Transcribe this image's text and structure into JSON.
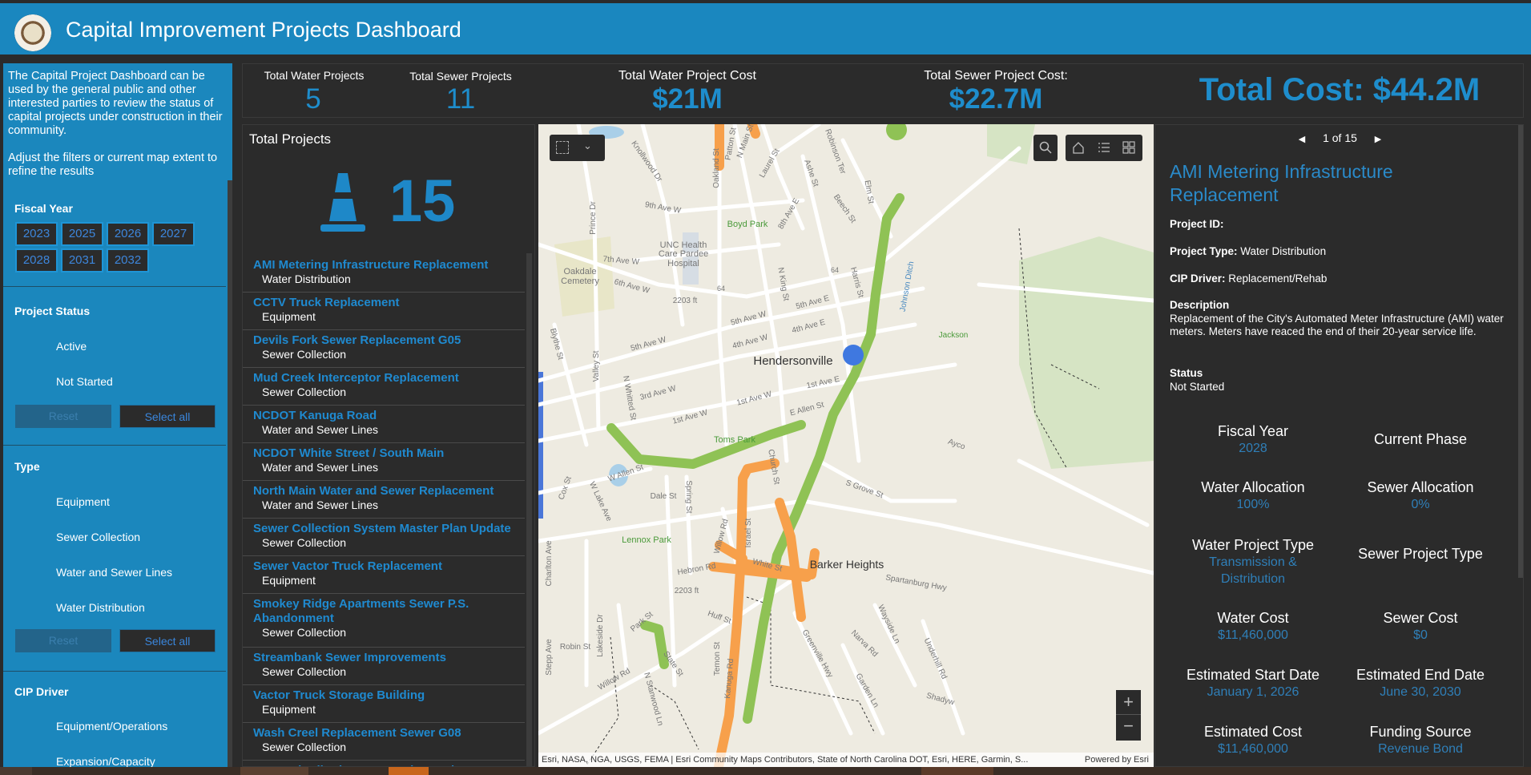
{
  "header": {
    "title": "Capital Improvement Projects Dashboard",
    "logo": "city-seal"
  },
  "sidebar": {
    "intro": "The Capital Project Dashboard can be used by the general public and other interested parties to review the status of capital projects under construction in their community.",
    "intro2": "Adjust the filters or current map extent to refine the results",
    "fiscal_year": {
      "label": "Fiscal Year",
      "years": [
        "2023",
        "2025",
        "2026",
        "2027",
        "2028",
        "2031",
        "2032"
      ]
    },
    "project_status": {
      "label": "Project Status",
      "options": [
        "Active",
        "Not Started"
      ],
      "reset": "Reset",
      "select_all": "Select all"
    },
    "type": {
      "label": "Type",
      "options": [
        "Equipment",
        "Sewer Collection",
        "Water and Sewer Lines",
        "Water Distribution"
      ],
      "reset": "Reset",
      "select_all": "Select all"
    },
    "cip_driver": {
      "label": "CIP Driver",
      "options": [
        "Equipment/Operations",
        "Expansion/Capacity"
      ]
    }
  },
  "stats": {
    "water_projects": {
      "label": "Total Water Projects",
      "value": "5"
    },
    "sewer_projects": {
      "label": "Total Sewer Projects",
      "value": "11"
    },
    "water_cost": {
      "label": "Total Water Project Cost",
      "value": "$21M"
    },
    "sewer_cost": {
      "label": "Total Sewer Project Cost:",
      "value": "$22.7M"
    },
    "total_cost": "Total Cost: $44.2M"
  },
  "list": {
    "title": "Total Projects",
    "count": "15",
    "icon": "traffic-cone-icon",
    "items": [
      {
        "title": "AMI Metering Infrastructure Replacement",
        "type": "Water Distribution"
      },
      {
        "title": "CCTV Truck Replacement",
        "type": "Equipment"
      },
      {
        "title": "Devils Fork Sewer Replacement G05",
        "type": "Sewer Collection"
      },
      {
        "title": "Mud Creek Interceptor Replacement",
        "type": "Sewer Collection"
      },
      {
        "title": "NCDOT Kanuga Road",
        "type": "Water and Sewer Lines"
      },
      {
        "title": "NCDOT White Street / South Main",
        "type": "Water and Sewer Lines"
      },
      {
        "title": "North Main Water and Sewer Replacement",
        "type": "Water and Sewer Lines"
      },
      {
        "title": "Sewer Collection System Master Plan Update",
        "type": "Sewer Collection"
      },
      {
        "title": "Sewer Vactor Truck Replacement",
        "type": "Equipment"
      },
      {
        "title": "Smokey Ridge Apartments Sewer P.S. Abandonment",
        "type": "Sewer Collection"
      },
      {
        "title": "Streambank Sewer Improvements",
        "type": "Sewer Collection"
      },
      {
        "title": "Vactor Truck Storage Building",
        "type": "Equipment"
      },
      {
        "title": "Wash Creel Replacement Sewer G08",
        "type": "Sewer Collection"
      },
      {
        "title": "Water Distribution Master Plan Update",
        "type": ""
      }
    ]
  },
  "map": {
    "attribution": "Esri, NASA, NGA, USGS, FEMA | Esri Community Maps Contributors, State of North Carolina DOT, Esri, HERE, Garmin, S...",
    "powered_by": "Powered by Esri",
    "colors": {
      "water": "#8fc255",
      "sewer": "#f7a04b",
      "point": "#3f78e0"
    },
    "labels": [
      "Hendersonville",
      "Barker Heights",
      "Boyd Park",
      "Toms Park",
      "Lennox Park",
      "Oakdale",
      "Cemetery",
      "UNC Health",
      "Care Pardee",
      "Hospital",
      "9th Ave W",
      "7th Ave W",
      "6th Ave W",
      "5th Ave W",
      "5th Ave W",
      "4th Ave W",
      "5th Ave E",
      "4th Ave E",
      "3rd Ave W",
      "1st Ave W",
      "1st Ave W",
      "1st Ave E",
      "E Allen St",
      "N King St",
      "Harris St",
      "Prince Dr",
      "Valley St",
      "N Whitted St",
      "Blythe St",
      "Oakland St",
      "Patton St",
      "N Main St",
      "Laurel St",
      "Ashe St",
      "Robinson Ter",
      "8th Ave E",
      "Beech St",
      "Elm St",
      "Knollwood Dr",
      "Johnson Ditch",
      "Jackson",
      "2203 ft",
      "W Allen St",
      "Cox St",
      "W Lake Ave",
      "Dale St",
      "Spring St",
      "Willow Rd",
      "Israel St",
      "Church St",
      "Hebron Rd",
      "White St",
      "S Grove St",
      "Spartanburg Hwy",
      "2203 ft",
      "Huff St",
      "Park St",
      "Charlton Ave",
      "Robin St",
      "Stepp Ave",
      "Lakeside Dr",
      "Willow Rd",
      "N Stanwood Ln",
      "State St",
      "Temon St",
      "Kanuga Rd",
      "Greenville Hwy",
      "Wayside Ln",
      "Narva Rd",
      "Garden Ln",
      "Underhill Rd",
      "Shadyw",
      "Ayco",
      "64",
      "64"
    ]
  },
  "detail": {
    "pager": "1 of 15",
    "title": "AMI Metering Infrastructure Replacement",
    "project_id_label": "Project ID:",
    "project_id": "",
    "project_type_label": "Project Type:",
    "project_type": "Water Distribution",
    "cip_driver_label": "CIP Driver:",
    "cip_driver": "Replacement/Rehab",
    "description_label": "Description",
    "description": "Replacement of the City's Automated Meter Infrastructure (AMI) water meters. Meters have reaced the end of their 20-year service life.",
    "status_label": "Status",
    "status": "Not Started",
    "fields": [
      {
        "label": "Fiscal Year",
        "value": "2028"
      },
      {
        "label": "Current Phase",
        "value": ""
      },
      {
        "label": "Water Allocation",
        "value": "100%"
      },
      {
        "label": "Sewer Allocation",
        "value": "0%"
      },
      {
        "label": "Water Project Type",
        "value": "Transmission & Distribution"
      },
      {
        "label": "Sewer Project Type",
        "value": ""
      },
      {
        "label": "Water Cost",
        "value": "$11,460,000"
      },
      {
        "label": "Sewer Cost",
        "value": "$0"
      },
      {
        "label": "Estimated Start Date",
        "value": "January 1, 2026"
      },
      {
        "label": "Estimated End Date",
        "value": "June 30, 2030"
      },
      {
        "label": "Estimated Cost",
        "value": "$11,460,000"
      },
      {
        "label": "Funding Source",
        "value": "Revenue Bond"
      }
    ]
  }
}
